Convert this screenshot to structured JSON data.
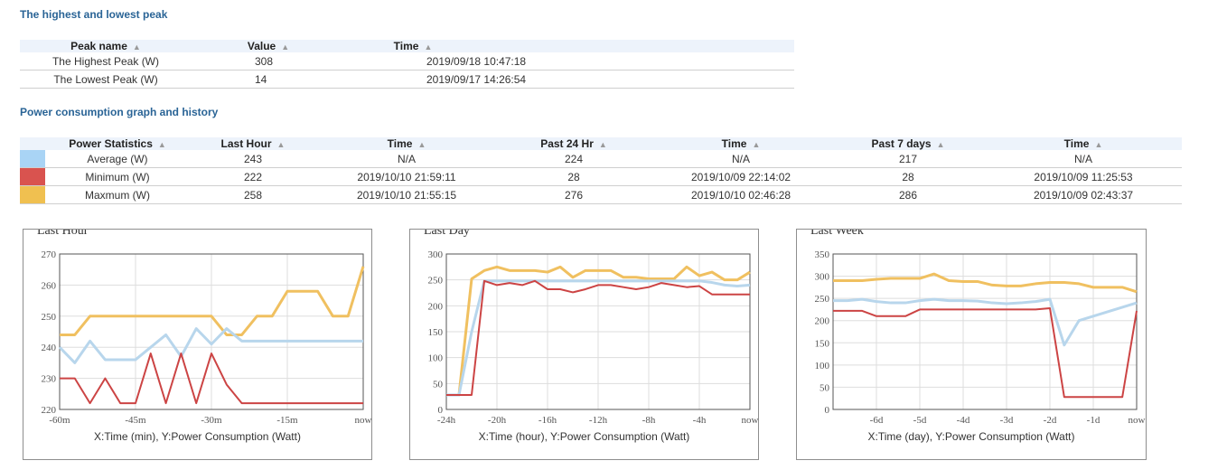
{
  "peaks": {
    "title": "The highest and lowest peak",
    "headers": [
      "Peak name",
      "Value",
      "Time"
    ],
    "rows": [
      {
        "name": "The Highest Peak (W)",
        "value": "308",
        "time": "2019/09/18 10:47:18"
      },
      {
        "name": "The Lowest Peak (W)",
        "value": "14",
        "time": "2019/09/17 14:26:54"
      }
    ]
  },
  "stats": {
    "title": "Power consumption graph and history",
    "headers": [
      "Power Statistics",
      "Last Hour",
      "Time",
      "Past 24 Hr",
      "Time",
      "Past 7 days",
      "Time"
    ],
    "rows": [
      {
        "color": "#a9d4f5",
        "label": "Average (W)",
        "hour": "243",
        "hour_time": "N/A",
        "day": "224",
        "day_time": "N/A",
        "week": "217",
        "week_time": "N/A"
      },
      {
        "color": "#d9534f",
        "label": "Minimum (W)",
        "hour": "222",
        "hour_time": "2019/10/10 21:59:11",
        "day": "28",
        "day_time": "2019/10/09 22:14:02",
        "week": "28",
        "week_time": "2019/10/09 11:25:53"
      },
      {
        "color": "#f0c050",
        "label": "Maxmum (W)",
        "hour": "258",
        "hour_time": "2019/10/10 21:55:15",
        "day": "276",
        "day_time": "2019/10/10 02:46:28",
        "week": "286",
        "week_time": "2019/10/09 02:43:37"
      }
    ]
  },
  "colors": {
    "average": "#b8d6ec",
    "minimum": "#cc4444",
    "maximum": "#f0c060"
  },
  "chart_data": [
    {
      "type": "line",
      "legend": "Last Hour",
      "xlabel": "X:Time (min), Y:Power Consumption (Watt)",
      "ylim": [
        220,
        270
      ],
      "yticks": [
        220,
        230,
        240,
        250,
        260,
        270
      ],
      "xticks": [
        {
          "x": -60,
          "label": "-60m"
        },
        {
          "x": -45,
          "label": "-45m"
        },
        {
          "x": -30,
          "label": "-30m"
        },
        {
          "x": -15,
          "label": "-15m"
        },
        {
          "x": 0,
          "label": "now"
        }
      ],
      "xlim": [
        -60,
        0
      ],
      "x": [
        -60,
        -57,
        -54,
        -51,
        -48,
        -45,
        -42,
        -39,
        -36,
        -33,
        -30,
        -27,
        -24,
        -21,
        -18,
        -15,
        -12,
        -9,
        -6,
        -3,
        0
      ],
      "series": [
        {
          "key": "maximum",
          "values": [
            244,
            244,
            250,
            250,
            250,
            250,
            250,
            250,
            250,
            250,
            250,
            244,
            244,
            250,
            250,
            258,
            258,
            258,
            250,
            250,
            266
          ]
        },
        {
          "key": "average",
          "values": [
            240,
            235,
            242,
            236,
            236,
            236,
            240,
            244,
            237,
            246,
            241,
            246,
            242,
            242,
            242,
            242,
            242,
            242,
            242,
            242,
            242
          ]
        },
        {
          "key": "minimum",
          "values": [
            230,
            230,
            222,
            230,
            222,
            222,
            238,
            222,
            238,
            222,
            238,
            228,
            222,
            222,
            222,
            222,
            222,
            222,
            222,
            222,
            222
          ]
        }
      ]
    },
    {
      "type": "line",
      "legend": "Last Day",
      "xlabel": "X:Time (hour), Y:Power Consumption (Watt)",
      "ylim": [
        0,
        300
      ],
      "yticks": [
        0,
        50,
        100,
        150,
        200,
        250,
        300
      ],
      "xticks": [
        {
          "x": -24,
          "label": "-24h"
        },
        {
          "x": -20,
          "label": "-20h"
        },
        {
          "x": -16,
          "label": "-16h"
        },
        {
          "x": -12,
          "label": "-12h"
        },
        {
          "x": -8,
          "label": "-8h"
        },
        {
          "x": -4,
          "label": "-4h"
        },
        {
          "x": 0,
          "label": "now"
        }
      ],
      "xlim": [
        -24,
        0
      ],
      "x": [
        -24,
        -23,
        -22,
        -21,
        -20,
        -19,
        -18,
        -17,
        -16,
        -15,
        -14,
        -13,
        -12,
        -11,
        -10,
        -9,
        -8,
        -7,
        -6,
        -5,
        -4,
        -3,
        -2,
        -1,
        0
      ],
      "series": [
        {
          "key": "maximum",
          "values": [
            28,
            28,
            252,
            268,
            275,
            268,
            268,
            268,
            265,
            275,
            255,
            268,
            268,
            268,
            255,
            255,
            252,
            252,
            252,
            275,
            258,
            265,
            250,
            250,
            265
          ]
        },
        {
          "key": "average",
          "values": [
            28,
            28,
            150,
            248,
            248,
            248,
            248,
            248,
            248,
            248,
            248,
            248,
            248,
            248,
            248,
            248,
            248,
            248,
            248,
            248,
            248,
            245,
            240,
            238,
            240
          ]
        },
        {
          "key": "minimum",
          "values": [
            28,
            28,
            28,
            248,
            240,
            244,
            240,
            248,
            232,
            232,
            226,
            232,
            240,
            240,
            236,
            232,
            236,
            244,
            240,
            236,
            238,
            222,
            222,
            222,
            222
          ]
        }
      ]
    },
    {
      "type": "line",
      "legend": "Last Week",
      "xlabel": "X:Time (day), Y:Power Consumption (Watt)",
      "ylim": [
        0,
        350
      ],
      "yticks": [
        0,
        50,
        100,
        150,
        200,
        250,
        300,
        350
      ],
      "xticks": [
        {
          "x": -6,
          "label": "-6d"
        },
        {
          "x": -5,
          "label": "-5d"
        },
        {
          "x": -4,
          "label": "-4d"
        },
        {
          "x": -3,
          "label": "-3d"
        },
        {
          "x": -2,
          "label": "-2d"
        },
        {
          "x": -1,
          "label": "-1d"
        },
        {
          "x": 0,
          "label": "now"
        }
      ],
      "xlim": [
        -7,
        0
      ],
      "x": [
        -7,
        -6.67,
        -6.33,
        -6,
        -5.67,
        -5.33,
        -5,
        -4.67,
        -4.33,
        -4,
        -3.67,
        -3.33,
        -3,
        -2.67,
        -2.33,
        -2,
        -1.67,
        -1.33,
        -1,
        -0.67,
        -0.33,
        0
      ],
      "series": [
        {
          "key": "maximum",
          "values": [
            290,
            290,
            290,
            293,
            295,
            295,
            295,
            305,
            290,
            288,
            288,
            280,
            278,
            278,
            283,
            286,
            286,
            283,
            275,
            275,
            275,
            265
          ]
        },
        {
          "key": "average",
          "values": [
            245,
            245,
            248,
            243,
            240,
            240,
            245,
            248,
            245,
            245,
            244,
            240,
            238,
            240,
            243,
            248,
            145,
            200,
            210,
            220,
            230,
            240
          ]
        },
        {
          "key": "minimum",
          "values": [
            222,
            222,
            222,
            210,
            210,
            210,
            225,
            225,
            225,
            225,
            225,
            225,
            225,
            225,
            225,
            228,
            28,
            28,
            28,
            28,
            28,
            222
          ]
        }
      ]
    }
  ]
}
